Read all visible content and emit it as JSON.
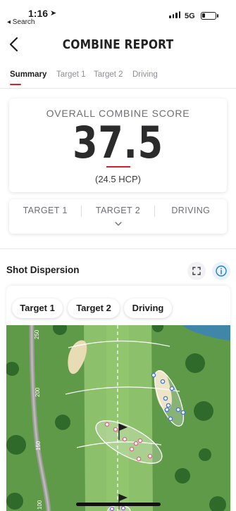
{
  "status_bar": {
    "time": "1:16",
    "back_app": "◂ Search",
    "network": "5G"
  },
  "header": {
    "title": "COMBINE REPORT"
  },
  "tabs": [
    {
      "label": "Summary",
      "active": true
    },
    {
      "label": "Target 1",
      "active": false
    },
    {
      "label": "Target 2",
      "active": false
    },
    {
      "label": "Driving",
      "active": false
    }
  ],
  "score_card": {
    "label": "OVERALL COMBINE SCORE",
    "value": "37.5",
    "handicap": "(24.5 HCP)"
  },
  "targets_card": {
    "columns": [
      "TARGET 1",
      "TARGET 2",
      "DRIVING"
    ]
  },
  "shot_dispersion": {
    "title": "Shot Dispersion",
    "filters": [
      "Target 1",
      "Target 2",
      "Driving"
    ],
    "yardage_markers": [
      "250",
      "200",
      "150",
      "100"
    ]
  },
  "colors": {
    "accent_red": "#d4202c",
    "info_blue": "#1a7fd6",
    "fairway": "#8cc06a",
    "rough": "#5f9a48"
  }
}
